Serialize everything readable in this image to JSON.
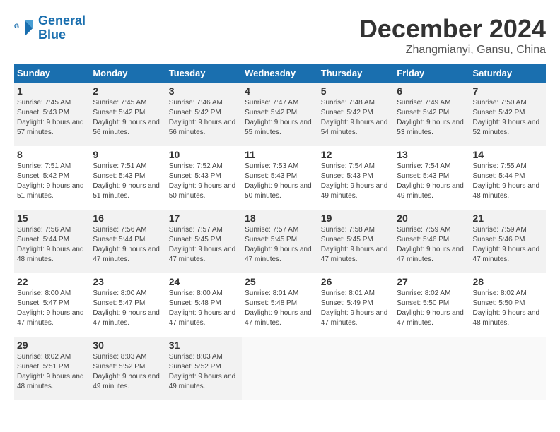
{
  "logo": {
    "line1": "General",
    "line2": "Blue"
  },
  "title": "December 2024",
  "location": "Zhangmianyi, Gansu, China",
  "days_of_week": [
    "Sunday",
    "Monday",
    "Tuesday",
    "Wednesday",
    "Thursday",
    "Friday",
    "Saturday"
  ],
  "weeks": [
    [
      {
        "day": 1,
        "sunrise": "7:45 AM",
        "sunset": "5:43 PM",
        "daylight": "9 hours and 57 minutes."
      },
      {
        "day": 2,
        "sunrise": "7:45 AM",
        "sunset": "5:42 PM",
        "daylight": "9 hours and 56 minutes."
      },
      {
        "day": 3,
        "sunrise": "7:46 AM",
        "sunset": "5:42 PM",
        "daylight": "9 hours and 56 minutes."
      },
      {
        "day": 4,
        "sunrise": "7:47 AM",
        "sunset": "5:42 PM",
        "daylight": "9 hours and 55 minutes."
      },
      {
        "day": 5,
        "sunrise": "7:48 AM",
        "sunset": "5:42 PM",
        "daylight": "9 hours and 54 minutes."
      },
      {
        "day": 6,
        "sunrise": "7:49 AM",
        "sunset": "5:42 PM",
        "daylight": "9 hours and 53 minutes."
      },
      {
        "day": 7,
        "sunrise": "7:50 AM",
        "sunset": "5:42 PM",
        "daylight": "9 hours and 52 minutes."
      }
    ],
    [
      {
        "day": 8,
        "sunrise": "7:51 AM",
        "sunset": "5:42 PM",
        "daylight": "9 hours and 51 minutes."
      },
      {
        "day": 9,
        "sunrise": "7:51 AM",
        "sunset": "5:43 PM",
        "daylight": "9 hours and 51 minutes."
      },
      {
        "day": 10,
        "sunrise": "7:52 AM",
        "sunset": "5:43 PM",
        "daylight": "9 hours and 50 minutes."
      },
      {
        "day": 11,
        "sunrise": "7:53 AM",
        "sunset": "5:43 PM",
        "daylight": "9 hours and 50 minutes."
      },
      {
        "day": 12,
        "sunrise": "7:54 AM",
        "sunset": "5:43 PM",
        "daylight": "9 hours and 49 minutes."
      },
      {
        "day": 13,
        "sunrise": "7:54 AM",
        "sunset": "5:43 PM",
        "daylight": "9 hours and 49 minutes."
      },
      {
        "day": 14,
        "sunrise": "7:55 AM",
        "sunset": "5:44 PM",
        "daylight": "9 hours and 48 minutes."
      }
    ],
    [
      {
        "day": 15,
        "sunrise": "7:56 AM",
        "sunset": "5:44 PM",
        "daylight": "9 hours and 48 minutes."
      },
      {
        "day": 16,
        "sunrise": "7:56 AM",
        "sunset": "5:44 PM",
        "daylight": "9 hours and 47 minutes."
      },
      {
        "day": 17,
        "sunrise": "7:57 AM",
        "sunset": "5:45 PM",
        "daylight": "9 hours and 47 minutes."
      },
      {
        "day": 18,
        "sunrise": "7:57 AM",
        "sunset": "5:45 PM",
        "daylight": "9 hours and 47 minutes."
      },
      {
        "day": 19,
        "sunrise": "7:58 AM",
        "sunset": "5:45 PM",
        "daylight": "9 hours and 47 minutes."
      },
      {
        "day": 20,
        "sunrise": "7:59 AM",
        "sunset": "5:46 PM",
        "daylight": "9 hours and 47 minutes."
      },
      {
        "day": 21,
        "sunrise": "7:59 AM",
        "sunset": "5:46 PM",
        "daylight": "9 hours and 47 minutes."
      }
    ],
    [
      {
        "day": 22,
        "sunrise": "8:00 AM",
        "sunset": "5:47 PM",
        "daylight": "9 hours and 47 minutes."
      },
      {
        "day": 23,
        "sunrise": "8:00 AM",
        "sunset": "5:47 PM",
        "daylight": "9 hours and 47 minutes."
      },
      {
        "day": 24,
        "sunrise": "8:00 AM",
        "sunset": "5:48 PM",
        "daylight": "9 hours and 47 minutes."
      },
      {
        "day": 25,
        "sunrise": "8:01 AM",
        "sunset": "5:48 PM",
        "daylight": "9 hours and 47 minutes."
      },
      {
        "day": 26,
        "sunrise": "8:01 AM",
        "sunset": "5:49 PM",
        "daylight": "9 hours and 47 minutes."
      },
      {
        "day": 27,
        "sunrise": "8:02 AM",
        "sunset": "5:50 PM",
        "daylight": "9 hours and 47 minutes."
      },
      {
        "day": 28,
        "sunrise": "8:02 AM",
        "sunset": "5:50 PM",
        "daylight": "9 hours and 48 minutes."
      }
    ],
    [
      {
        "day": 29,
        "sunrise": "8:02 AM",
        "sunset": "5:51 PM",
        "daylight": "9 hours and 48 minutes."
      },
      {
        "day": 30,
        "sunrise": "8:03 AM",
        "sunset": "5:52 PM",
        "daylight": "9 hours and 49 minutes."
      },
      {
        "day": 31,
        "sunrise": "8:03 AM",
        "sunset": "5:52 PM",
        "daylight": "9 hours and 49 minutes."
      },
      null,
      null,
      null,
      null
    ]
  ]
}
